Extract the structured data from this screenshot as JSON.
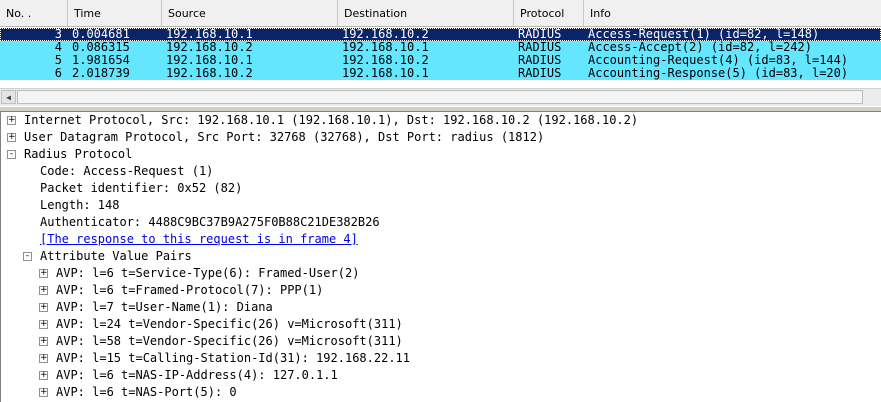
{
  "columns": {
    "no": "No. .",
    "time": "Time",
    "source": "Source",
    "destination": "Destination",
    "protocol": "Protocol",
    "info": "Info"
  },
  "packets": [
    {
      "no": "3",
      "time": "0.004681",
      "src": "192.168.10.1",
      "dst": "192.168.10.2",
      "proto": "RADIUS",
      "info": "Access-Request(1) (id=82, l=148)",
      "selected": true
    },
    {
      "no": "4",
      "time": "0.086315",
      "src": "192.168.10.2",
      "dst": "192.168.10.1",
      "proto": "RADIUS",
      "info": "Access-Accept(2) (id=82, l=242)",
      "selected": false
    },
    {
      "no": "5",
      "time": "1.981654",
      "src": "192.168.10.1",
      "dst": "192.168.10.2",
      "proto": "RADIUS",
      "info": "Accounting-Request(4) (id=83, l=144)",
      "selected": false
    },
    {
      "no": "6",
      "time": "2.018739",
      "src": "192.168.10.2",
      "dst": "192.168.10.1",
      "proto": "RADIUS",
      "info": "Accounting-Response(5) (id=83, l=20)",
      "selected": false
    }
  ],
  "colors": {
    "row_bg": "#65e6ff",
    "selected_bg": "#0a246a",
    "link": "#0000ee"
  },
  "tree": {
    "ip": "Internet Protocol, Src: 192.168.10.1 (192.168.10.1), Dst: 192.168.10.2 (192.168.10.2)",
    "udp": "User Datagram Protocol, Src Port: 32768 (32768), Dst Port: radius (1812)",
    "radius": "Radius Protocol",
    "code": "Code: Access-Request (1)",
    "packet_id": "Packet identifier: 0x52 (82)",
    "length": "Length: 148",
    "authenticator": "Authenticator: 4488C9BC37B9A275F0B88C21DE382B26",
    "response_link": "[The response to this request is in frame 4]",
    "avp_header": "Attribute Value Pairs",
    "avps": [
      "AVP: l=6  t=Service-Type(6): Framed-User(2)",
      "AVP: l=6  t=Framed-Protocol(7): PPP(1)",
      "AVP: l=7  t=User-Name(1): Diana",
      "AVP: l=24  t=Vendor-Specific(26) v=Microsoft(311)",
      "AVP: l=58  t=Vendor-Specific(26) v=Microsoft(311)",
      "AVP: l=15  t=Calling-Station-Id(31): 192.168.22.11",
      "AVP: l=6  t=NAS-IP-Address(4): 127.0.1.1",
      "AVP: l=6  t=NAS-Port(5): 0"
    ]
  },
  "icons": {
    "expand": "+",
    "collapse": "-",
    "scroll_left": "◀",
    "sort": "▾"
  }
}
